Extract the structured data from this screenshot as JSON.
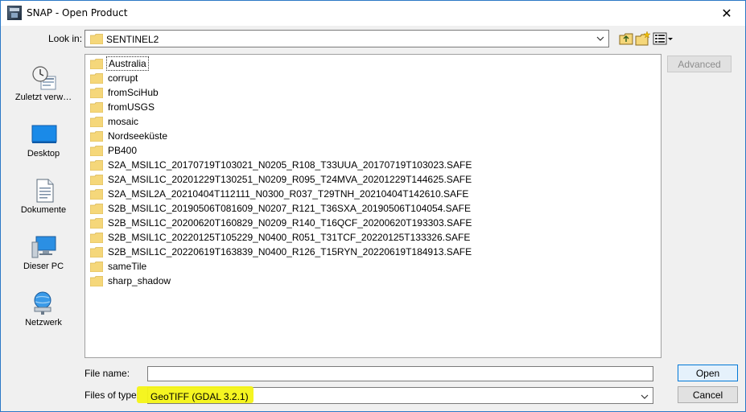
{
  "window": {
    "title": "SNAP - Open Product",
    "close_glyph": "✕"
  },
  "lookin": {
    "label": "Look in:",
    "value": "SENTINEL2"
  },
  "toolbar": {
    "advanced_label": "Advanced"
  },
  "places": [
    {
      "label": "Zuletzt verw…",
      "icon": "recent-icon"
    },
    {
      "label": "Desktop",
      "icon": "desktop-icon"
    },
    {
      "label": "Dokumente",
      "icon": "documents-icon"
    },
    {
      "label": "Dieser PC",
      "icon": "computer-icon"
    },
    {
      "label": "Netzwerk",
      "icon": "network-icon"
    }
  ],
  "files": [
    "Australia",
    "corrupt",
    "fromSciHub",
    "fromUSGS",
    "mosaic",
    "Nordseeküste",
    "PB400",
    "S2A_MSIL1C_20170719T103021_N0205_R108_T33UUA_20170719T103023.SAFE",
    "S2A_MSIL1C_20201229T130251_N0209_R095_T24MVA_20201229T144625.SAFE",
    "S2A_MSIL2A_20210404T112111_N0300_R037_T29TNH_20210404T142610.SAFE",
    "S2B_MSIL1C_20190506T081609_N0207_R121_T36SXA_20190506T104054.SAFE",
    "S2B_MSIL1C_20200620T160829_N0209_R140_T16QCF_20200620T193303.SAFE",
    "S2B_MSIL1C_20220125T105229_N0400_R051_T31TCF_20220125T133326.SAFE",
    "S2B_MSIL1C_20220619T163839_N0400_R126_T15RYN_20220619T184913.SAFE",
    "sameTile",
    "sharp_shadow"
  ],
  "form": {
    "filename_label": "File name:",
    "filename_value": "",
    "type_label": "Files of type:",
    "type_value": "GeoTIFF (GDAL 3.2.1)"
  },
  "buttons": {
    "open": "Open",
    "cancel": "Cancel"
  },
  "colors": {
    "highlight": "#f4f415",
    "folder": "#f5d77a",
    "accent": "#0078d7"
  }
}
